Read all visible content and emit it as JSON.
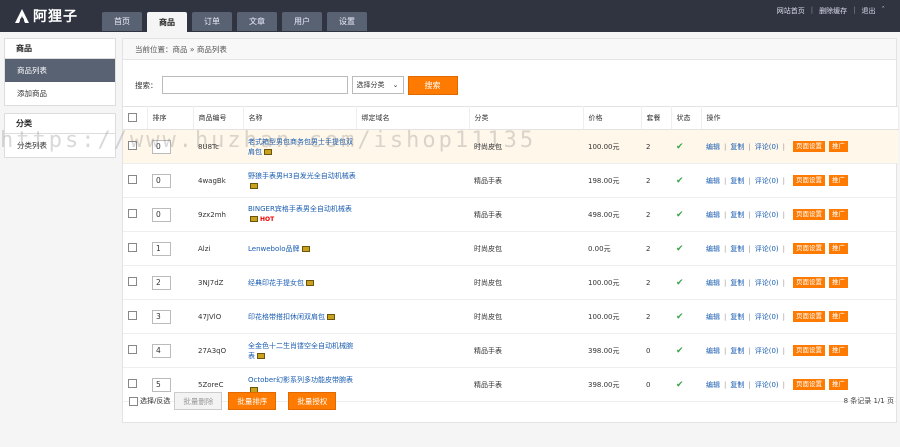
{
  "brand": {
    "name": "阿狸子"
  },
  "nav": [
    {
      "label": "首页",
      "active": false
    },
    {
      "label": "商品",
      "active": true
    },
    {
      "label": "订单",
      "active": false
    },
    {
      "label": "文章",
      "active": false
    },
    {
      "label": "用户",
      "active": false
    },
    {
      "label": "设置",
      "active": false
    }
  ],
  "top_links": {
    "site_home": "网站首页",
    "clear_cache": "删除缓存",
    "logout": "退出"
  },
  "sidebar": [
    {
      "title": "商品",
      "items": [
        {
          "label": "商品列表",
          "active": true
        },
        {
          "label": "添加商品",
          "active": false
        }
      ]
    },
    {
      "title": "分类",
      "items": [
        {
          "label": "分类列表",
          "active": false
        }
      ]
    }
  ],
  "breadcrumb": "当前位置：商品 » 商品列表",
  "search": {
    "label": "搜索：",
    "value": "",
    "placeholder": "",
    "select_label": "选择分类",
    "button": "搜索"
  },
  "table": {
    "headers": {
      "sort": "排序",
      "code": "商品编号",
      "name": "名称",
      "domain": "绑定域名",
      "category": "分类",
      "price": "价格",
      "stock": "套餐",
      "status": "状态",
      "ops": "操作"
    },
    "op_labels": {
      "edit": "编辑",
      "copy": "复制",
      "comments": "评论(0)",
      "page_settings": "页面设置",
      "promote": "推广"
    },
    "rows": [
      {
        "sort": "0",
        "code": "8U8Tc",
        "name": "老式箱型男包商务包男士手提包双肩包",
        "hot": false,
        "domain": "",
        "category": "时尚皮包",
        "price": "100.00元",
        "stock": "2",
        "highlight": true
      },
      {
        "sort": "0",
        "code": "4wagBk",
        "name": "野狼手表男H3自发光全自动机械表",
        "hot": false,
        "domain": "",
        "category": "精品手表",
        "price": "198.00元",
        "stock": "2",
        "highlight": false
      },
      {
        "sort": "0",
        "code": "9zx2mh",
        "name": "BINGER宾格手表男全自动机械表",
        "hot": true,
        "domain": "",
        "category": "精品手表",
        "price": "498.00元",
        "stock": "2",
        "highlight": false
      },
      {
        "sort": "1",
        "code": "Alzi",
        "name": "Lenwebolo品牌",
        "hot": false,
        "domain": "",
        "category": "时尚皮包",
        "price": "0.00元",
        "stock": "2",
        "highlight": false
      },
      {
        "sort": "2",
        "code": "3NJ7dZ",
        "name": "经典印花手提女包",
        "hot": false,
        "domain": "",
        "category": "时尚皮包",
        "price": "100.00元",
        "stock": "2",
        "highlight": false
      },
      {
        "sort": "3",
        "code": "47JVlO",
        "name": "印花格带搭扣休闲双肩包",
        "hot": false,
        "domain": "",
        "category": "时尚皮包",
        "price": "100.00元",
        "stock": "2",
        "highlight": false
      },
      {
        "sort": "4",
        "code": "27A3qO",
        "name": "全金色十二生肖镂空全自动机械腕表",
        "hot": false,
        "domain": "",
        "category": "精品手表",
        "price": "398.00元",
        "stock": "0",
        "highlight": false
      },
      {
        "sort": "5",
        "code": "5ZoreC",
        "name": "October幻影系列多功能皮带腕表",
        "hot": false,
        "domain": "",
        "category": "精品手表",
        "price": "398.00元",
        "stock": "0",
        "highlight": false
      }
    ]
  },
  "footer": {
    "select_all": "选择/反选",
    "batch_delete": "批量删除",
    "batch_sort": "批量排序",
    "batch_auth": "批量授权",
    "records": "8 条记录 1/1 页"
  },
  "watermark": "https://www.huzhan.com/ishop11135",
  "colors": {
    "accent": "#ff7a00",
    "topbar": "#2f3440",
    "link": "#1a5db1",
    "status_ok": "#3aa34a"
  }
}
